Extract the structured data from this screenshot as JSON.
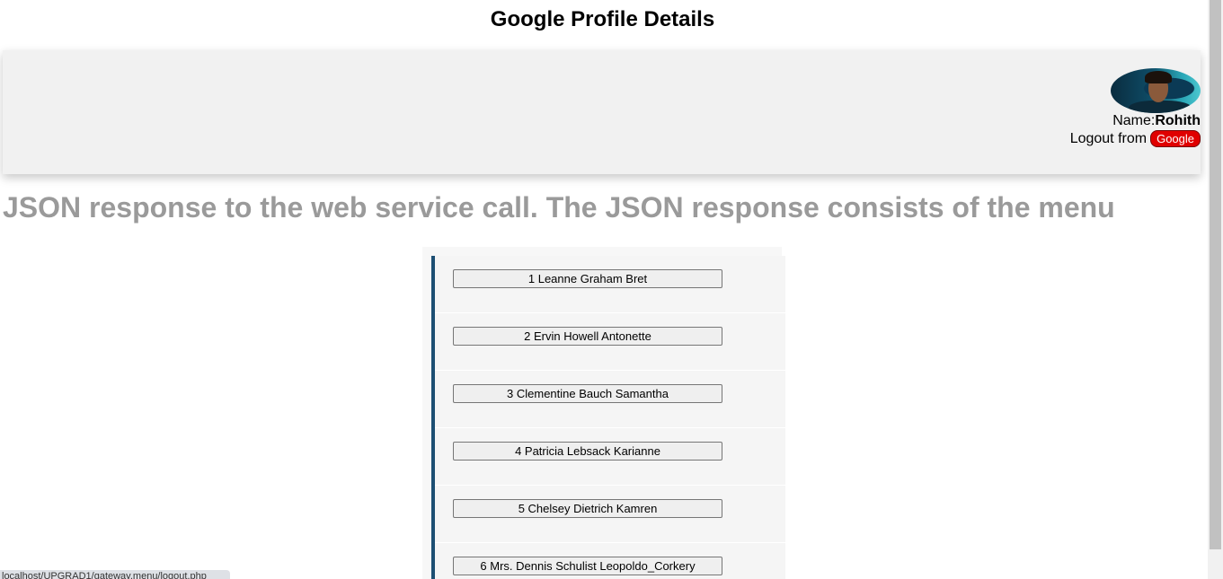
{
  "page": {
    "title": "Google Profile Details"
  },
  "profile": {
    "name_label": "Name:",
    "name_value": "Rohith",
    "logout_label": "Logout from",
    "logout_button": "Google"
  },
  "section": {
    "heading": "JSON response to the web service call. The JSON response consists of the menu"
  },
  "menu": {
    "items": [
      {
        "label": "1 Leanne Graham Bret"
      },
      {
        "label": "2 Ervin Howell Antonette"
      },
      {
        "label": "3 Clementine Bauch Samantha"
      },
      {
        "label": "4 Patricia Lebsack Karianne"
      },
      {
        "label": "5 Chelsey Dietrich Kamren"
      },
      {
        "label": "6 Mrs. Dennis Schulist Leopoldo_Corkery"
      }
    ]
  },
  "status_bar": {
    "text": "localhost/UPGRAD1/gateway.menu/logout.php"
  }
}
